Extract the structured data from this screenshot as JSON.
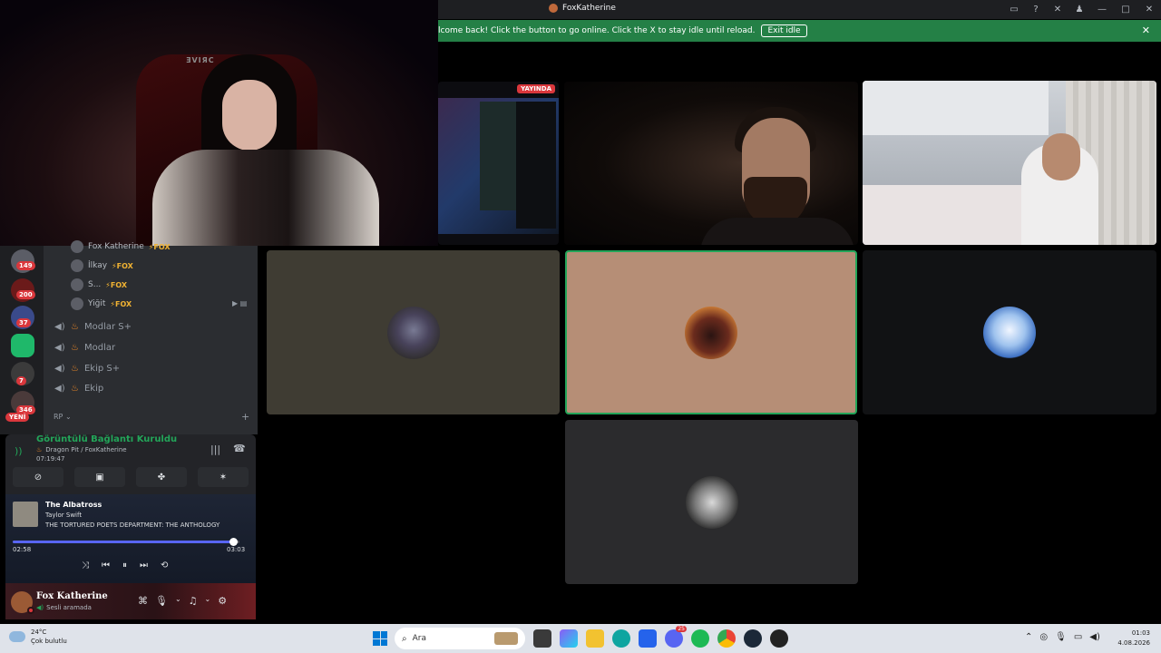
{
  "window": {
    "title": "FoxKatherine",
    "icons": [
      "inbox-icon",
      "help-icon",
      "tools-icon",
      "people-icon"
    ],
    "controls": {
      "minimize": "—",
      "maximize": "□",
      "close": "✕"
    }
  },
  "notice": {
    "message": "lcome back! Click the button to go online. Click the X to stay idle until reload.",
    "button": "Exit idle",
    "close": "✕"
  },
  "stream": {
    "live_badge": "YAYINDA"
  },
  "servers": {
    "badges": [
      "149",
      "200",
      "37",
      "7",
      "346"
    ],
    "new_badge": "YENİ"
  },
  "voice_channel": {
    "users": [
      {
        "name": "Fox Katherine",
        "tag": "⚡FOX"
      },
      {
        "name": "İlkay",
        "tag": "⚡FOX"
      },
      {
        "name": "S...",
        "tag": "⚡FOX"
      },
      {
        "name": "Yiğit",
        "tag": "⚡FOX"
      }
    ],
    "channels": [
      "Modlar S+",
      "Modlar",
      "Ekip S+",
      "Ekip"
    ],
    "category": "RP",
    "category_chevron": "⌄",
    "add": "+"
  },
  "voice_panel": {
    "title": "Görüntülü Bağlantı Kuruldu",
    "server": "Dragon Pit / FoxKatherine",
    "elapsed": "07:19:47"
  },
  "music": {
    "title": "The Albatross",
    "artist": "Taylor Swift",
    "album": "THE TORTURED POETS DEPARTMENT: THE ANTHOLOGY",
    "current": "02:58",
    "duration": "03:03",
    "progress": 0.97
  },
  "user": {
    "name": "Fox Katherine",
    "status": "Sesli aramada"
  },
  "taskbar": {
    "weather_temp": "24°C",
    "weather_desc": "Çok bulutlu",
    "search_placeholder": "Ara",
    "app_badge": "25",
    "time": "01:03",
    "date": "4.08.2026"
  },
  "colors": {
    "green": "#23a559",
    "red": "#da373c",
    "blurple": "#5865f2"
  }
}
